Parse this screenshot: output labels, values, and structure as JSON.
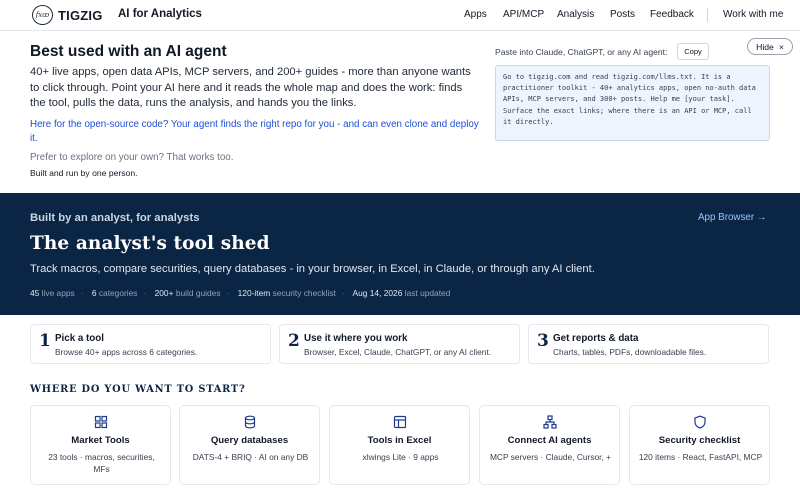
{
  "nav": {
    "logo_text": "fxꝏ",
    "brand": "TIGZIG",
    "tagline": "AI for Analytics",
    "links": [
      "Apps",
      "API/MCP",
      "Analysis",
      "Posts",
      "Feedback"
    ],
    "cta": "Work with me"
  },
  "agent": {
    "title": "Best used with an AI agent",
    "body": "40+ live apps, open data APIs, MCP servers, and 200+ guides - more than anyone wants to click through. Point your AI here and it reads the whole map and does the work: finds the tool, pulls the data, runs the analysis, and hands you the links.",
    "open_source_link": "Here for the open-source code? Your agent finds the right repo for you - and can even clone and deploy it.",
    "explore": "Prefer to explore on your own? That works too.",
    "built_by": "Built and run by one person.",
    "paste_label": "Paste into Claude, ChatGPT, or any AI agent:",
    "copy_label": "Copy",
    "hide_label": "Hide",
    "hide_icon": "×",
    "prompt": "Go to tigzig.com and read tigzig.com/llms.txt. It is a practitioner toolkit - 40+ analytics apps, open no-auth data APIs, MCP servers, and 300+ posts. Help me [your task]. Surface the exact links; where there is an API or MCP, call it directly."
  },
  "hero": {
    "eyebrow": "Built by an analyst, for analysts",
    "title": "The analyst's tool shed",
    "subtitle": "Track macros, compare securities, query databases - in your browser, in Excel, in Claude, or through any AI client.",
    "app_browser": "App Browser →",
    "stats": [
      {
        "value": "45",
        "label": "live apps"
      },
      {
        "value": "6",
        "label": "categories"
      },
      {
        "value": "200+",
        "label": "build guides"
      },
      {
        "value": "120-item",
        "label": "security checklist"
      },
      {
        "value": "Aug 14, 2026",
        "label": "last updated"
      }
    ]
  },
  "steps": [
    {
      "num": "1",
      "title": "Pick a tool",
      "desc": "Browse 40+ apps across 6 categories."
    },
    {
      "num": "2",
      "title": "Use it where you work",
      "desc": "Browser, Excel, Claude, ChatGPT, or any AI client."
    },
    {
      "num": "3",
      "title": "Get reports & data",
      "desc": "Charts, tables, PDFs, downloadable files."
    }
  ],
  "start": {
    "heading": "WHERE DO YOU WANT TO START?",
    "cards": [
      {
        "icon": "grid-icon",
        "title": "Market Tools",
        "desc": "23 tools · macros, securities, MFs"
      },
      {
        "icon": "database-icon",
        "title": "Query databases",
        "desc": "DATS-4 + BRIQ · AI on any DB"
      },
      {
        "icon": "spreadsheet-icon",
        "title": "Tools in Excel",
        "desc": "xlwings Lite · 9 apps"
      },
      {
        "icon": "network-icon",
        "title": "Connect AI agents",
        "desc": "MCP servers · Claude, Cursor, +"
      },
      {
        "icon": "shield-icon",
        "title": "Security checklist",
        "desc": "120 items · React, FastAPI, MCP"
      }
    ]
  },
  "colors": {
    "hero_bg": "#0b2545",
    "link_blue": "#1d4ed8",
    "prompt_bg": "#eef4fd",
    "icon_blue": "#1e3a8a"
  }
}
